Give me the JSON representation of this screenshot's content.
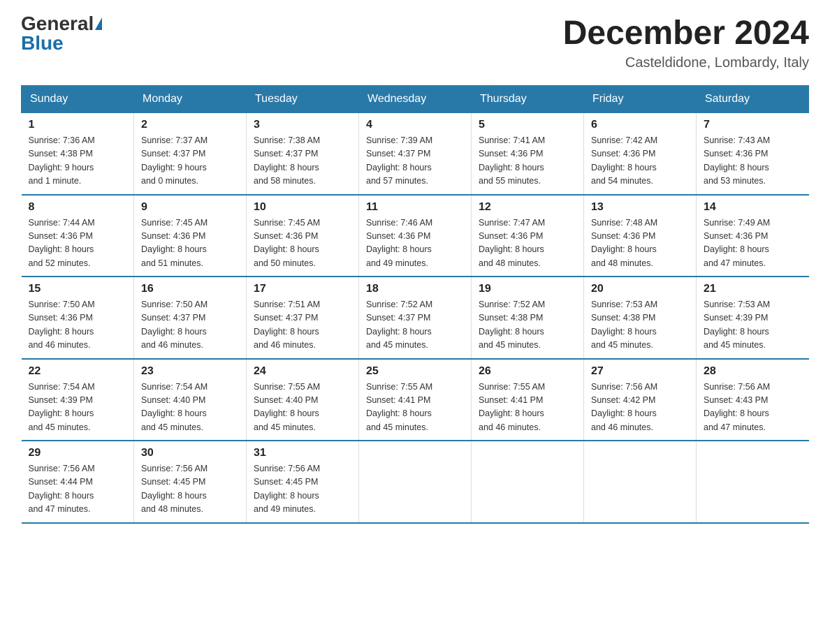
{
  "logo": {
    "general": "General",
    "blue": "Blue"
  },
  "title": "December 2024",
  "location": "Casteldidone, Lombardy, Italy",
  "weekdays": [
    "Sunday",
    "Monday",
    "Tuesday",
    "Wednesday",
    "Thursday",
    "Friday",
    "Saturday"
  ],
  "weeks": [
    [
      {
        "day": "1",
        "sunrise": "7:36 AM",
        "sunset": "4:38 PM",
        "daylight": "9 hours and 1 minute."
      },
      {
        "day": "2",
        "sunrise": "7:37 AM",
        "sunset": "4:37 PM",
        "daylight": "9 hours and 0 minutes."
      },
      {
        "day": "3",
        "sunrise": "7:38 AM",
        "sunset": "4:37 PM",
        "daylight": "8 hours and 58 minutes."
      },
      {
        "day": "4",
        "sunrise": "7:39 AM",
        "sunset": "4:37 PM",
        "daylight": "8 hours and 57 minutes."
      },
      {
        "day": "5",
        "sunrise": "7:41 AM",
        "sunset": "4:36 PM",
        "daylight": "8 hours and 55 minutes."
      },
      {
        "day": "6",
        "sunrise": "7:42 AM",
        "sunset": "4:36 PM",
        "daylight": "8 hours and 54 minutes."
      },
      {
        "day": "7",
        "sunrise": "7:43 AM",
        "sunset": "4:36 PM",
        "daylight": "8 hours and 53 minutes."
      }
    ],
    [
      {
        "day": "8",
        "sunrise": "7:44 AM",
        "sunset": "4:36 PM",
        "daylight": "8 hours and 52 minutes."
      },
      {
        "day": "9",
        "sunrise": "7:45 AM",
        "sunset": "4:36 PM",
        "daylight": "8 hours and 51 minutes."
      },
      {
        "day": "10",
        "sunrise": "7:45 AM",
        "sunset": "4:36 PM",
        "daylight": "8 hours and 50 minutes."
      },
      {
        "day": "11",
        "sunrise": "7:46 AM",
        "sunset": "4:36 PM",
        "daylight": "8 hours and 49 minutes."
      },
      {
        "day": "12",
        "sunrise": "7:47 AM",
        "sunset": "4:36 PM",
        "daylight": "8 hours and 48 minutes."
      },
      {
        "day": "13",
        "sunrise": "7:48 AM",
        "sunset": "4:36 PM",
        "daylight": "8 hours and 48 minutes."
      },
      {
        "day": "14",
        "sunrise": "7:49 AM",
        "sunset": "4:36 PM",
        "daylight": "8 hours and 47 minutes."
      }
    ],
    [
      {
        "day": "15",
        "sunrise": "7:50 AM",
        "sunset": "4:36 PM",
        "daylight": "8 hours and 46 minutes."
      },
      {
        "day": "16",
        "sunrise": "7:50 AM",
        "sunset": "4:37 PM",
        "daylight": "8 hours and 46 minutes."
      },
      {
        "day": "17",
        "sunrise": "7:51 AM",
        "sunset": "4:37 PM",
        "daylight": "8 hours and 46 minutes."
      },
      {
        "day": "18",
        "sunrise": "7:52 AM",
        "sunset": "4:37 PM",
        "daylight": "8 hours and 45 minutes."
      },
      {
        "day": "19",
        "sunrise": "7:52 AM",
        "sunset": "4:38 PM",
        "daylight": "8 hours and 45 minutes."
      },
      {
        "day": "20",
        "sunrise": "7:53 AM",
        "sunset": "4:38 PM",
        "daylight": "8 hours and 45 minutes."
      },
      {
        "day": "21",
        "sunrise": "7:53 AM",
        "sunset": "4:39 PM",
        "daylight": "8 hours and 45 minutes."
      }
    ],
    [
      {
        "day": "22",
        "sunrise": "7:54 AM",
        "sunset": "4:39 PM",
        "daylight": "8 hours and 45 minutes."
      },
      {
        "day": "23",
        "sunrise": "7:54 AM",
        "sunset": "4:40 PM",
        "daylight": "8 hours and 45 minutes."
      },
      {
        "day": "24",
        "sunrise": "7:55 AM",
        "sunset": "4:40 PM",
        "daylight": "8 hours and 45 minutes."
      },
      {
        "day": "25",
        "sunrise": "7:55 AM",
        "sunset": "4:41 PM",
        "daylight": "8 hours and 45 minutes."
      },
      {
        "day": "26",
        "sunrise": "7:55 AM",
        "sunset": "4:41 PM",
        "daylight": "8 hours and 46 minutes."
      },
      {
        "day": "27",
        "sunrise": "7:56 AM",
        "sunset": "4:42 PM",
        "daylight": "8 hours and 46 minutes."
      },
      {
        "day": "28",
        "sunrise": "7:56 AM",
        "sunset": "4:43 PM",
        "daylight": "8 hours and 47 minutes."
      }
    ],
    [
      {
        "day": "29",
        "sunrise": "7:56 AM",
        "sunset": "4:44 PM",
        "daylight": "8 hours and 47 minutes."
      },
      {
        "day": "30",
        "sunrise": "7:56 AM",
        "sunset": "4:45 PM",
        "daylight": "8 hours and 48 minutes."
      },
      {
        "day": "31",
        "sunrise": "7:56 AM",
        "sunset": "4:45 PM",
        "daylight": "8 hours and 49 minutes."
      },
      null,
      null,
      null,
      null
    ]
  ],
  "labels": {
    "sunrise": "Sunrise:",
    "sunset": "Sunset:",
    "daylight": "Daylight:"
  }
}
